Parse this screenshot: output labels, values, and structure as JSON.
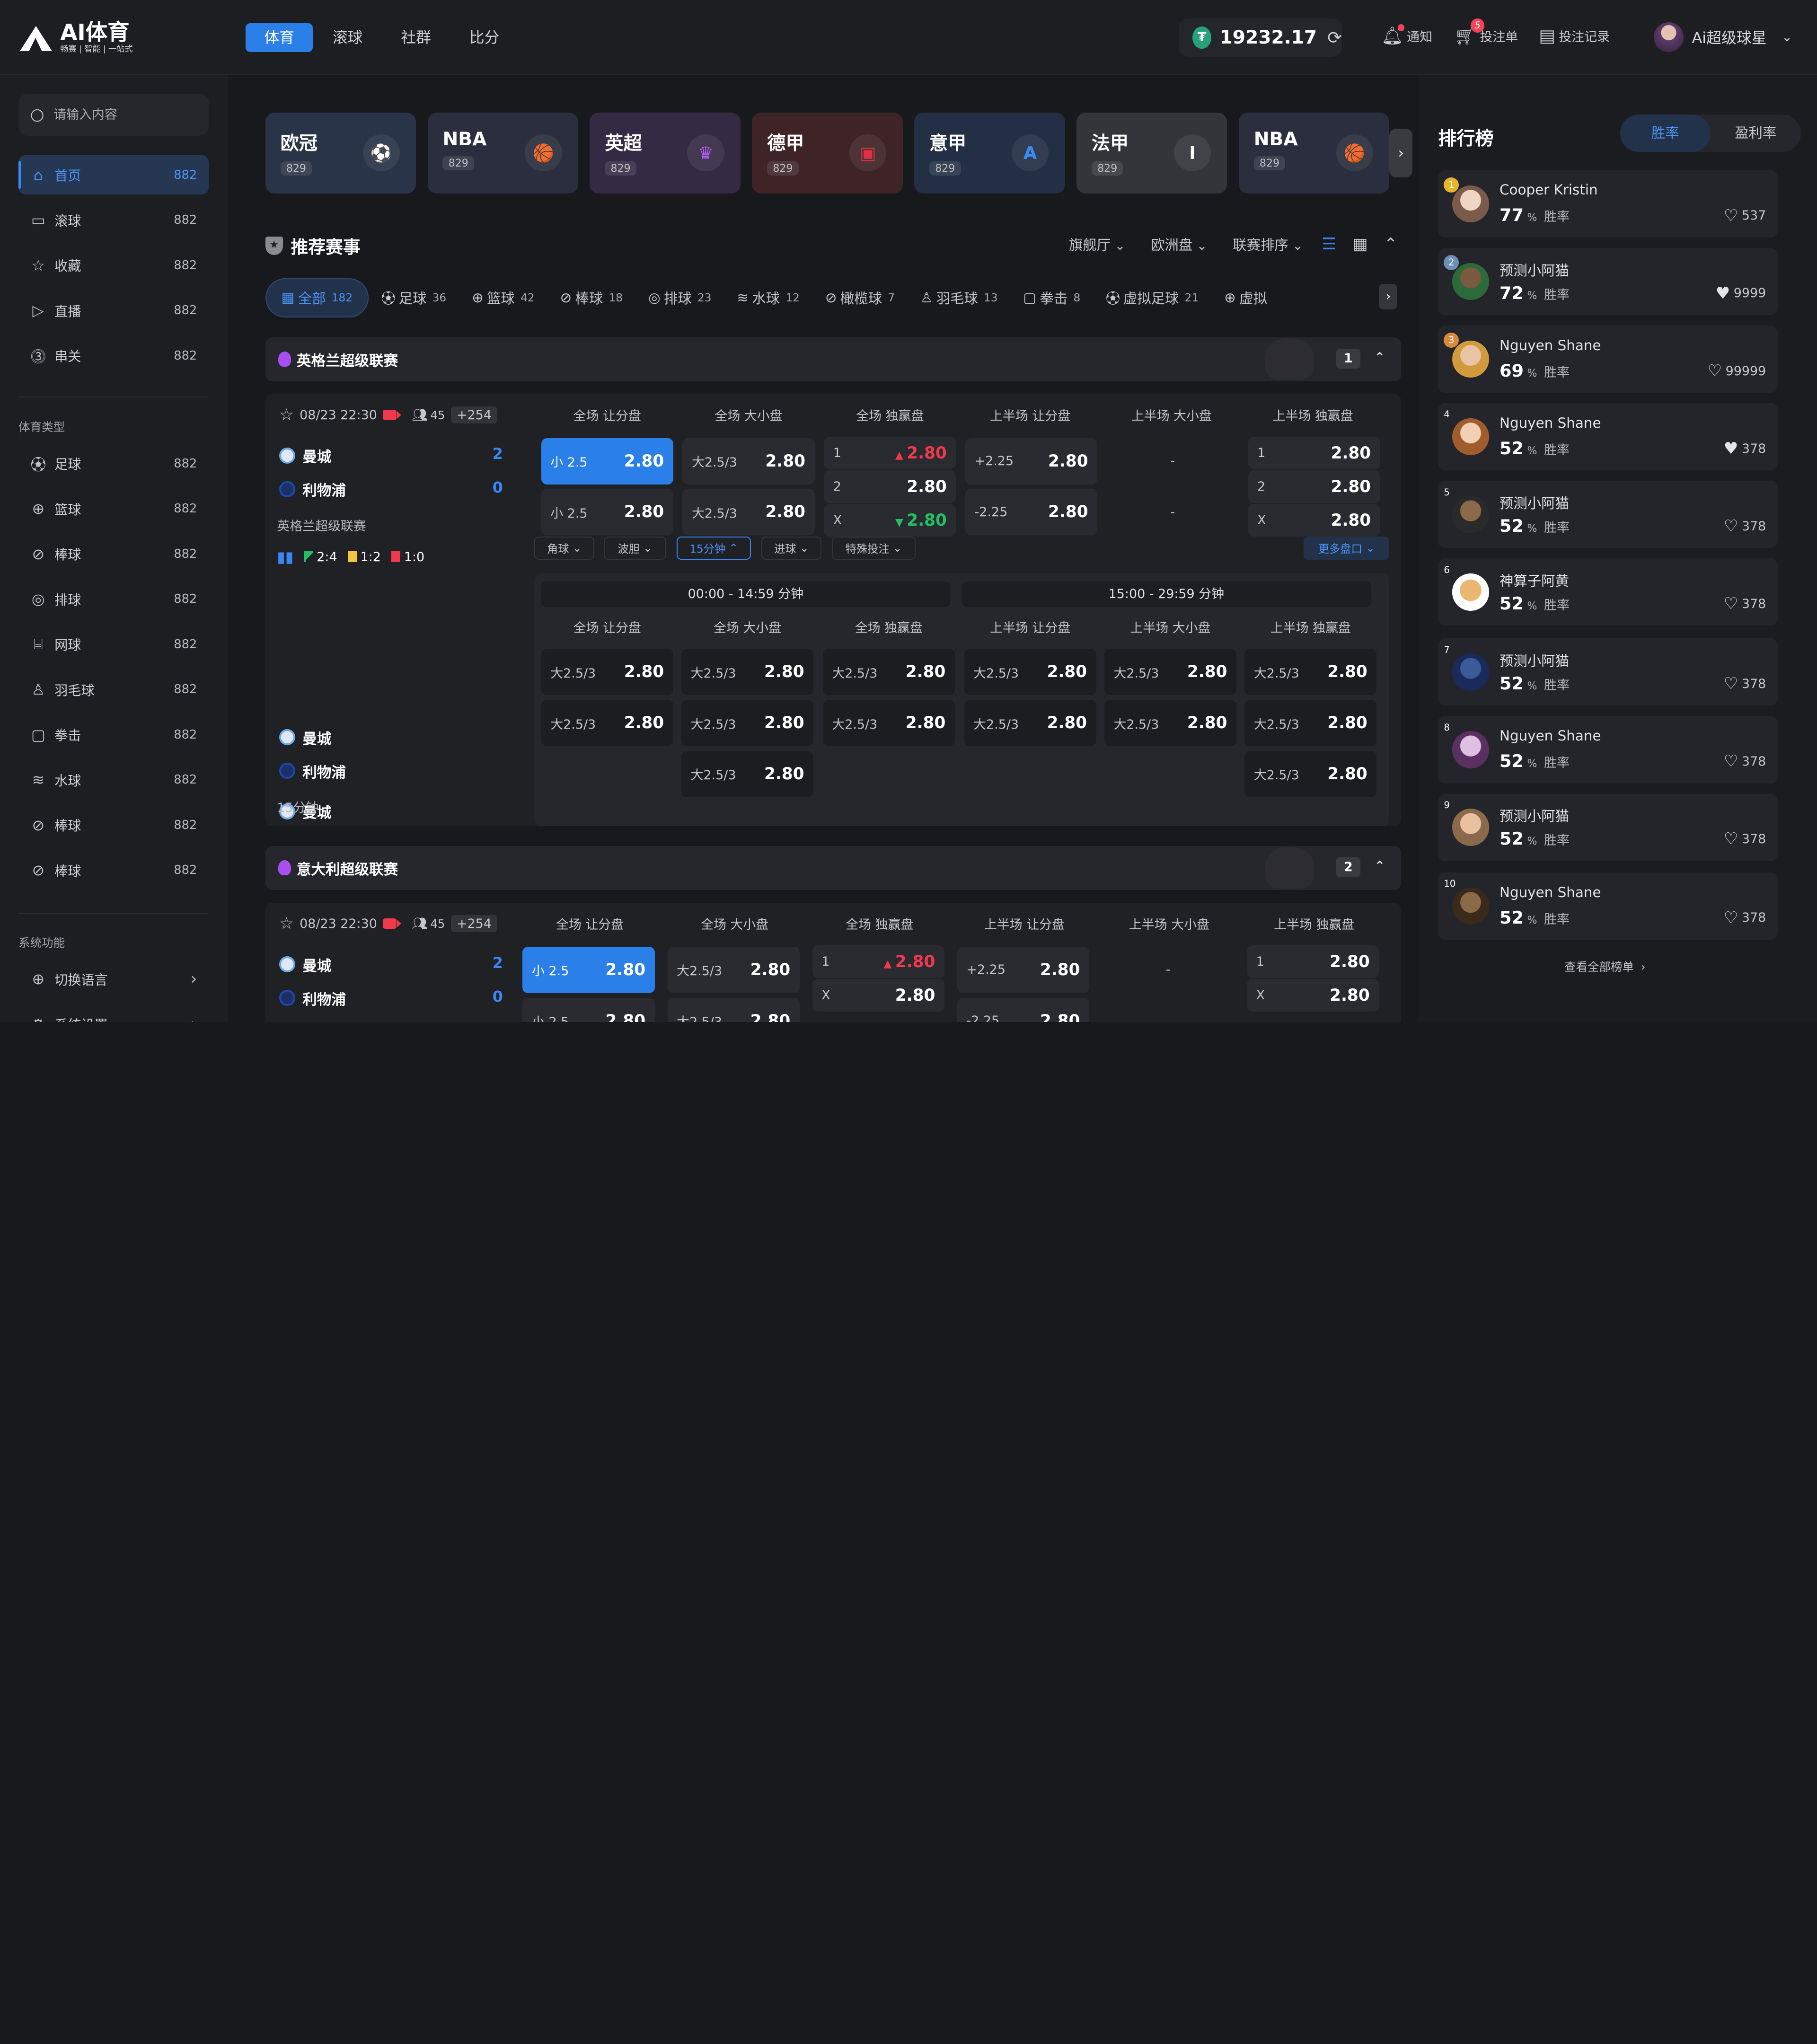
{
  "header": {
    "logo_title": "AI体育",
    "logo_sub": "畅赛 | 智能 | 一站式",
    "nav": [
      "体育",
      "滚球",
      "社群",
      "比分"
    ],
    "balance": "19232.17",
    "notify": "通知",
    "slip": "投注单",
    "slip_count": "5",
    "records": "投注记录",
    "username": "Ai超级球星"
  },
  "sidebar": {
    "search_placeholder": "请输入内容",
    "main": [
      {
        "label": "首页",
        "count": "882",
        "icon": "home-icon"
      },
      {
        "label": "滚球",
        "count": "882",
        "icon": "live-icon"
      },
      {
        "label": "收藏",
        "count": "882",
        "icon": "star-icon"
      },
      {
        "label": "直播",
        "count": "882",
        "icon": "play-icon"
      },
      {
        "label": "串关",
        "count": "882",
        "icon": "parlay-icon"
      }
    ],
    "sports_title": "体育类型",
    "sports": [
      {
        "label": "足球",
        "count": "882"
      },
      {
        "label": "篮球",
        "count": "882"
      },
      {
        "label": "棒球",
        "count": "882"
      },
      {
        "label": "排球",
        "count": "882"
      },
      {
        "label": "网球",
        "count": "882"
      },
      {
        "label": "羽毛球",
        "count": "882"
      },
      {
        "label": "拳击",
        "count": "882"
      },
      {
        "label": "水球",
        "count": "882"
      },
      {
        "label": "棒球",
        "count": "882"
      },
      {
        "label": "棒球",
        "count": "882"
      }
    ],
    "system_title": "系统功能",
    "language": "切换语言",
    "settings": "系统设置"
  },
  "leagues": [
    {
      "name": "欧冠",
      "count": "829",
      "bg": "#2a3448",
      "icon": "⚽",
      "icon_color": "#4d7cf0"
    },
    {
      "name": "NBA",
      "count": "829",
      "bg": "#2a2e3e",
      "icon": "🏀",
      "icon_color": "#e0e0e0"
    },
    {
      "name": "英超",
      "count": "829",
      "bg": "#352a44",
      "icon": "♛",
      "icon_color": "#b05cf6"
    },
    {
      "name": "德甲",
      "count": "829",
      "bg": "#3e2427",
      "icon": "▣",
      "icon_color": "#e33042"
    },
    {
      "name": "意甲",
      "count": "829",
      "bg": "#232f44",
      "icon": "A",
      "icon_color": "#3a8cf5"
    },
    {
      "name": "法甲",
      "count": "829",
      "bg": "#34353b",
      "icon": "l",
      "icon_color": "#ffffff"
    },
    {
      "name": "NBA",
      "count": "829",
      "bg": "#2a2e3e",
      "icon": "🏀",
      "icon_color": "#e0e0e0"
    }
  ],
  "rec": {
    "title": "推荐赛事",
    "filters": [
      "旗舰厅",
      "欧洲盘",
      "联赛排序"
    ]
  },
  "sport_tabs": [
    {
      "label": "全部",
      "count": "182"
    },
    {
      "label": "足球",
      "count": "36"
    },
    {
      "label": "篮球",
      "count": "42"
    },
    {
      "label": "棒球",
      "count": "18"
    },
    {
      "label": "排球",
      "count": "23"
    },
    {
      "label": "水球",
      "count": "12"
    },
    {
      "label": "橄榄球",
      "count": "7"
    },
    {
      "label": "羽毛球",
      "count": "13"
    },
    {
      "label": "拳击",
      "count": "8"
    },
    {
      "label": "虚拟足球",
      "count": "21"
    },
    {
      "label": "虚拟",
      "count": ""
    }
  ],
  "league1": {
    "name": "英格兰超级联赛",
    "badge": "1"
  },
  "league2": {
    "name": "意大利超级联赛",
    "badge": "2"
  },
  "match": {
    "time": "08/23 22:30",
    "viewers": "45",
    "plus": "+254",
    "home": "曼城",
    "away": "利物浦",
    "home_score": "2",
    "away_score": "0",
    "league": "英格兰超级联赛",
    "stat_corner": "2:4",
    "stat_yellow": "1:2",
    "stat_red": "1:0",
    "bottom_label": "15分钟"
  },
  "odds_headers": [
    "全场 让分盘",
    "全场 大小盘",
    "全场 独赢盘",
    "上半场 让分盘",
    "上半场 大小盘",
    "上半场 独赢盘"
  ],
  "odds": {
    "ah1_label": "小 2.5",
    "ah1": "2.80",
    "ah2_label": "小 2.5",
    "ah2": "2.80",
    "ou1_label": "大2.5/3",
    "ou1": "2.80",
    "ou2_label": "大2.5/3",
    "ou2": "2.80",
    "m1_label": "1",
    "m1": "2.80",
    "m2_label": "2",
    "m2": "2.80",
    "mx_label": "X",
    "mx": "2.80",
    "hah1_label": "+2.25",
    "hah1": "2.80",
    "hah2_label": "-2.25",
    "hah2": "2.80",
    "dash": "-",
    "h1_label": "1",
    "h1": "2.80",
    "h2_label": "2",
    "h2": "2.80",
    "hx_label": "X",
    "hx": "2.80"
  },
  "chips": [
    "角球",
    "波胆",
    "15分钟",
    "进球",
    "特殊投注"
  ],
  "more": "更多盘口",
  "periods": [
    "00:00 - 14:59 分钟",
    "15:00 - 29:59 分钟"
  ],
  "sub": {
    "label": "大2.5/3",
    "value": "2.80"
  },
  "ranking": {
    "title": "排行榜",
    "tabs": [
      "胜率",
      "盈利率"
    ],
    "winlabel": "胜率",
    "items": [
      {
        "rank": "1",
        "name": "Cooper Kristin",
        "pct": "77",
        "likes": "537",
        "filled": false
      },
      {
        "rank": "2",
        "name": "预测小阿猫",
        "pct": "72",
        "likes": "9999",
        "filled": true
      },
      {
        "rank": "3",
        "name": "Nguyen Shane",
        "pct": "69",
        "likes": "99999",
        "filled": false
      },
      {
        "rank": "4",
        "name": "Nguyen Shane",
        "pct": "52",
        "likes": "378",
        "filled": true
      },
      {
        "rank": "5",
        "name": "预测小阿猫",
        "pct": "52",
        "likes": "378",
        "filled": false
      },
      {
        "rank": "6",
        "name": "神算子阿黄",
        "pct": "52",
        "likes": "378",
        "filled": false
      },
      {
        "rank": "7",
        "name": "预测小阿猫",
        "pct": "52",
        "likes": "378",
        "filled": false
      },
      {
        "rank": "8",
        "name": "Nguyen Shane",
        "pct": "52",
        "likes": "378",
        "filled": false
      },
      {
        "rank": "9",
        "name": "预测小阿猫",
        "pct": "52",
        "likes": "378",
        "filled": false
      },
      {
        "rank": "10",
        "name": "Nguyen Shane",
        "pct": "52",
        "likes": "378",
        "filled": false
      }
    ],
    "see_all": "查看全部榜单"
  }
}
